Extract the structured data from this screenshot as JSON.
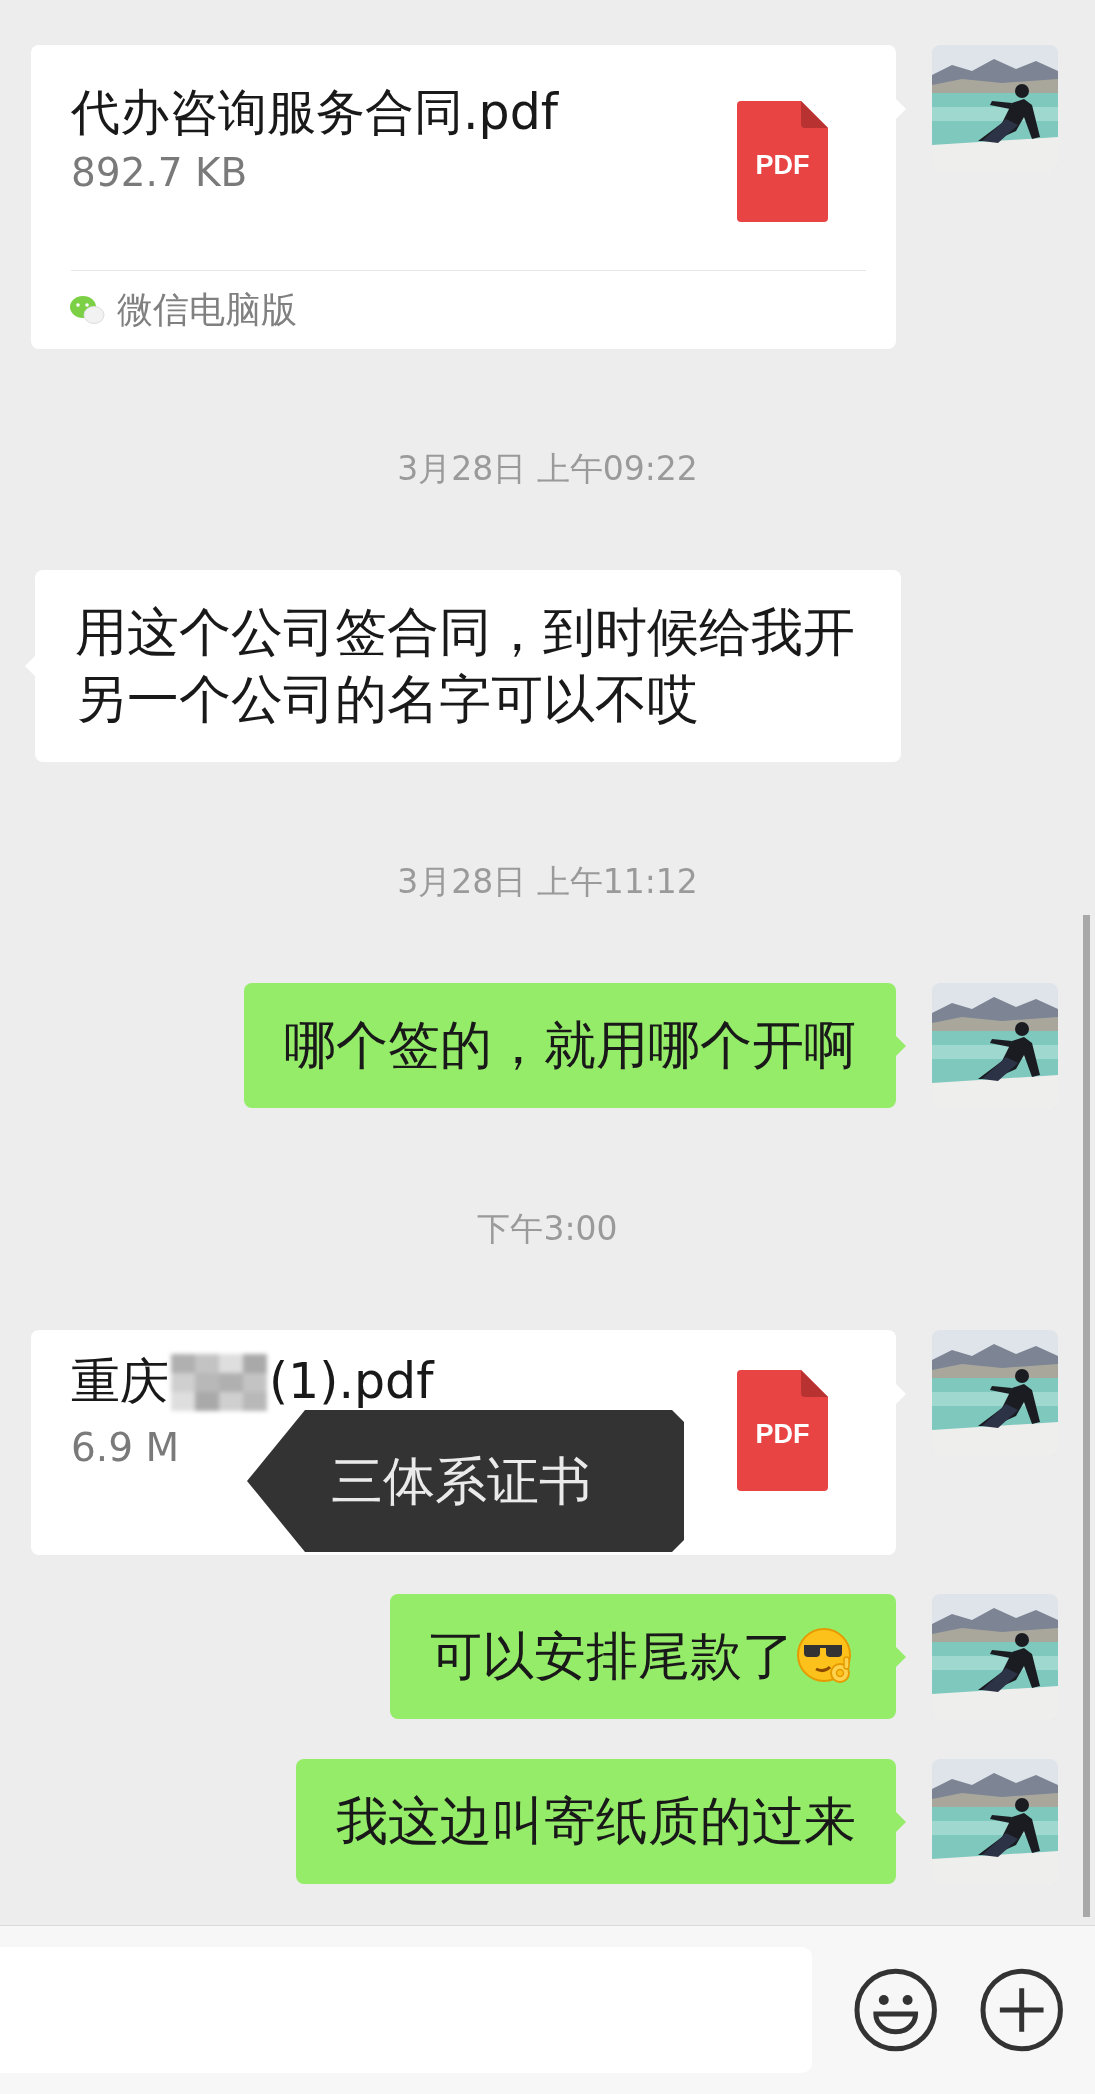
{
  "messages": [
    {
      "kind": "file",
      "outgoing": true,
      "file_name_parts": [
        "代办咨询服务合同.pdf"
      ],
      "redacted": false,
      "file_size": "892.7 KB",
      "file_type": "PDF",
      "source": "微信电脑版"
    },
    {
      "kind": "time",
      "text": "3月28日 上午09:22"
    },
    {
      "kind": "text",
      "outgoing": false,
      "text": "用这个公司签合同，到时候给我开另一个公司的名字可以不哎",
      "has_emoji": false
    },
    {
      "kind": "time",
      "text": "3月28日 上午11:12"
    },
    {
      "kind": "text",
      "outgoing": true,
      "text": "哪个签的，就用哪个开啊",
      "has_emoji": false
    },
    {
      "kind": "time",
      "text": "下午3:00"
    },
    {
      "kind": "file",
      "outgoing": true,
      "file_name_parts": [
        "重庆",
        "(1).pdf"
      ],
      "redacted": true,
      "file_size": "6.9 M",
      "file_type": "PDF",
      "tooltip": "三体系证书"
    },
    {
      "kind": "text",
      "outgoing": true,
      "text": "可以安排尾款了",
      "has_emoji": true
    },
    {
      "kind": "text",
      "outgoing": true,
      "text": "我这边叫寄纸质的过来",
      "has_emoji": false
    }
  ]
}
